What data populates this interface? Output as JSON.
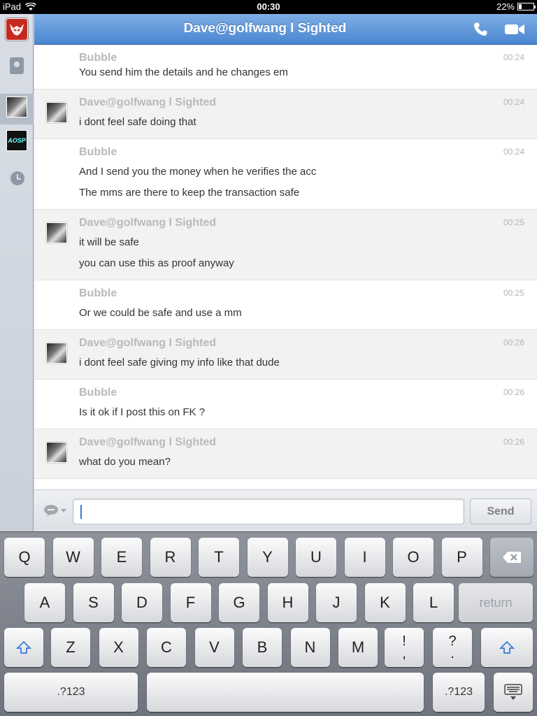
{
  "status_bar": {
    "device": "iPad",
    "time": "00:30",
    "battery": "22%",
    "battery_level": 0.22
  },
  "header": {
    "title": "Dave@golfwang l Sighted",
    "phone_icon": "phone-icon",
    "video_icon": "video-camera-icon"
  },
  "sidebar": {
    "logo_icon": "app-logo-icon",
    "items": [
      "contacts-icon",
      "avatar-dave",
      "avatar-aosp",
      "recent-clock-icon"
    ],
    "aosp_label": "AOSP"
  },
  "messages": [
    {
      "sender": "Bubble",
      "time": "00:24",
      "lines": [
        "You send him the details and he changes em"
      ],
      "avatar": false
    },
    {
      "sender": "Dave@golfwang l Sighted",
      "time": "00:24",
      "lines": [
        "i dont feel safe doing that"
      ],
      "avatar": true
    },
    {
      "sender": "Bubble",
      "time": "00:24",
      "lines": [
        "And I send you the money when he verifies the acc",
        "The mms are there to keep the transaction safe"
      ],
      "avatar": false
    },
    {
      "sender": "Dave@golfwang l Sighted",
      "time": "00:25",
      "lines": [
        "it will be safe",
        "you can use this as proof anyway"
      ],
      "avatar": true
    },
    {
      "sender": "Bubble",
      "time": "00:25",
      "lines": [
        "Or we could be safe and use a mm"
      ],
      "avatar": false
    },
    {
      "sender": "Dave@golfwang l Sighted",
      "time": "00:26",
      "lines": [
        "i dont feel safe giving my info like that dude"
      ],
      "avatar": true
    },
    {
      "sender": "Bubble",
      "time": "00:26",
      "lines": [
        "Is it ok if I post this on FK ?"
      ],
      "avatar": false
    },
    {
      "sender": "Dave@golfwang l Sighted",
      "time": "00:26",
      "lines": [
        "what do you mean?"
      ],
      "avatar": true
    }
  ],
  "input": {
    "value": "",
    "placeholder": "",
    "send_label": "Send"
  },
  "keyboard": {
    "row1": [
      "Q",
      "W",
      "E",
      "R",
      "T",
      "Y",
      "U",
      "I",
      "O",
      "P"
    ],
    "row2": [
      "A",
      "S",
      "D",
      "F",
      "G",
      "H",
      "J",
      "K",
      "L"
    ],
    "row3": [
      "Z",
      "X",
      "C",
      "V",
      "B",
      "N",
      "M"
    ],
    "return_label": "return",
    "numbers_label": ".?123",
    "punct1": [
      "!",
      ","
    ],
    "punct2": [
      "?",
      "."
    ]
  },
  "colors": {
    "header": "#4a86d0",
    "sender": "#b9b9b9",
    "alt_row": "#f2f2f2"
  }
}
